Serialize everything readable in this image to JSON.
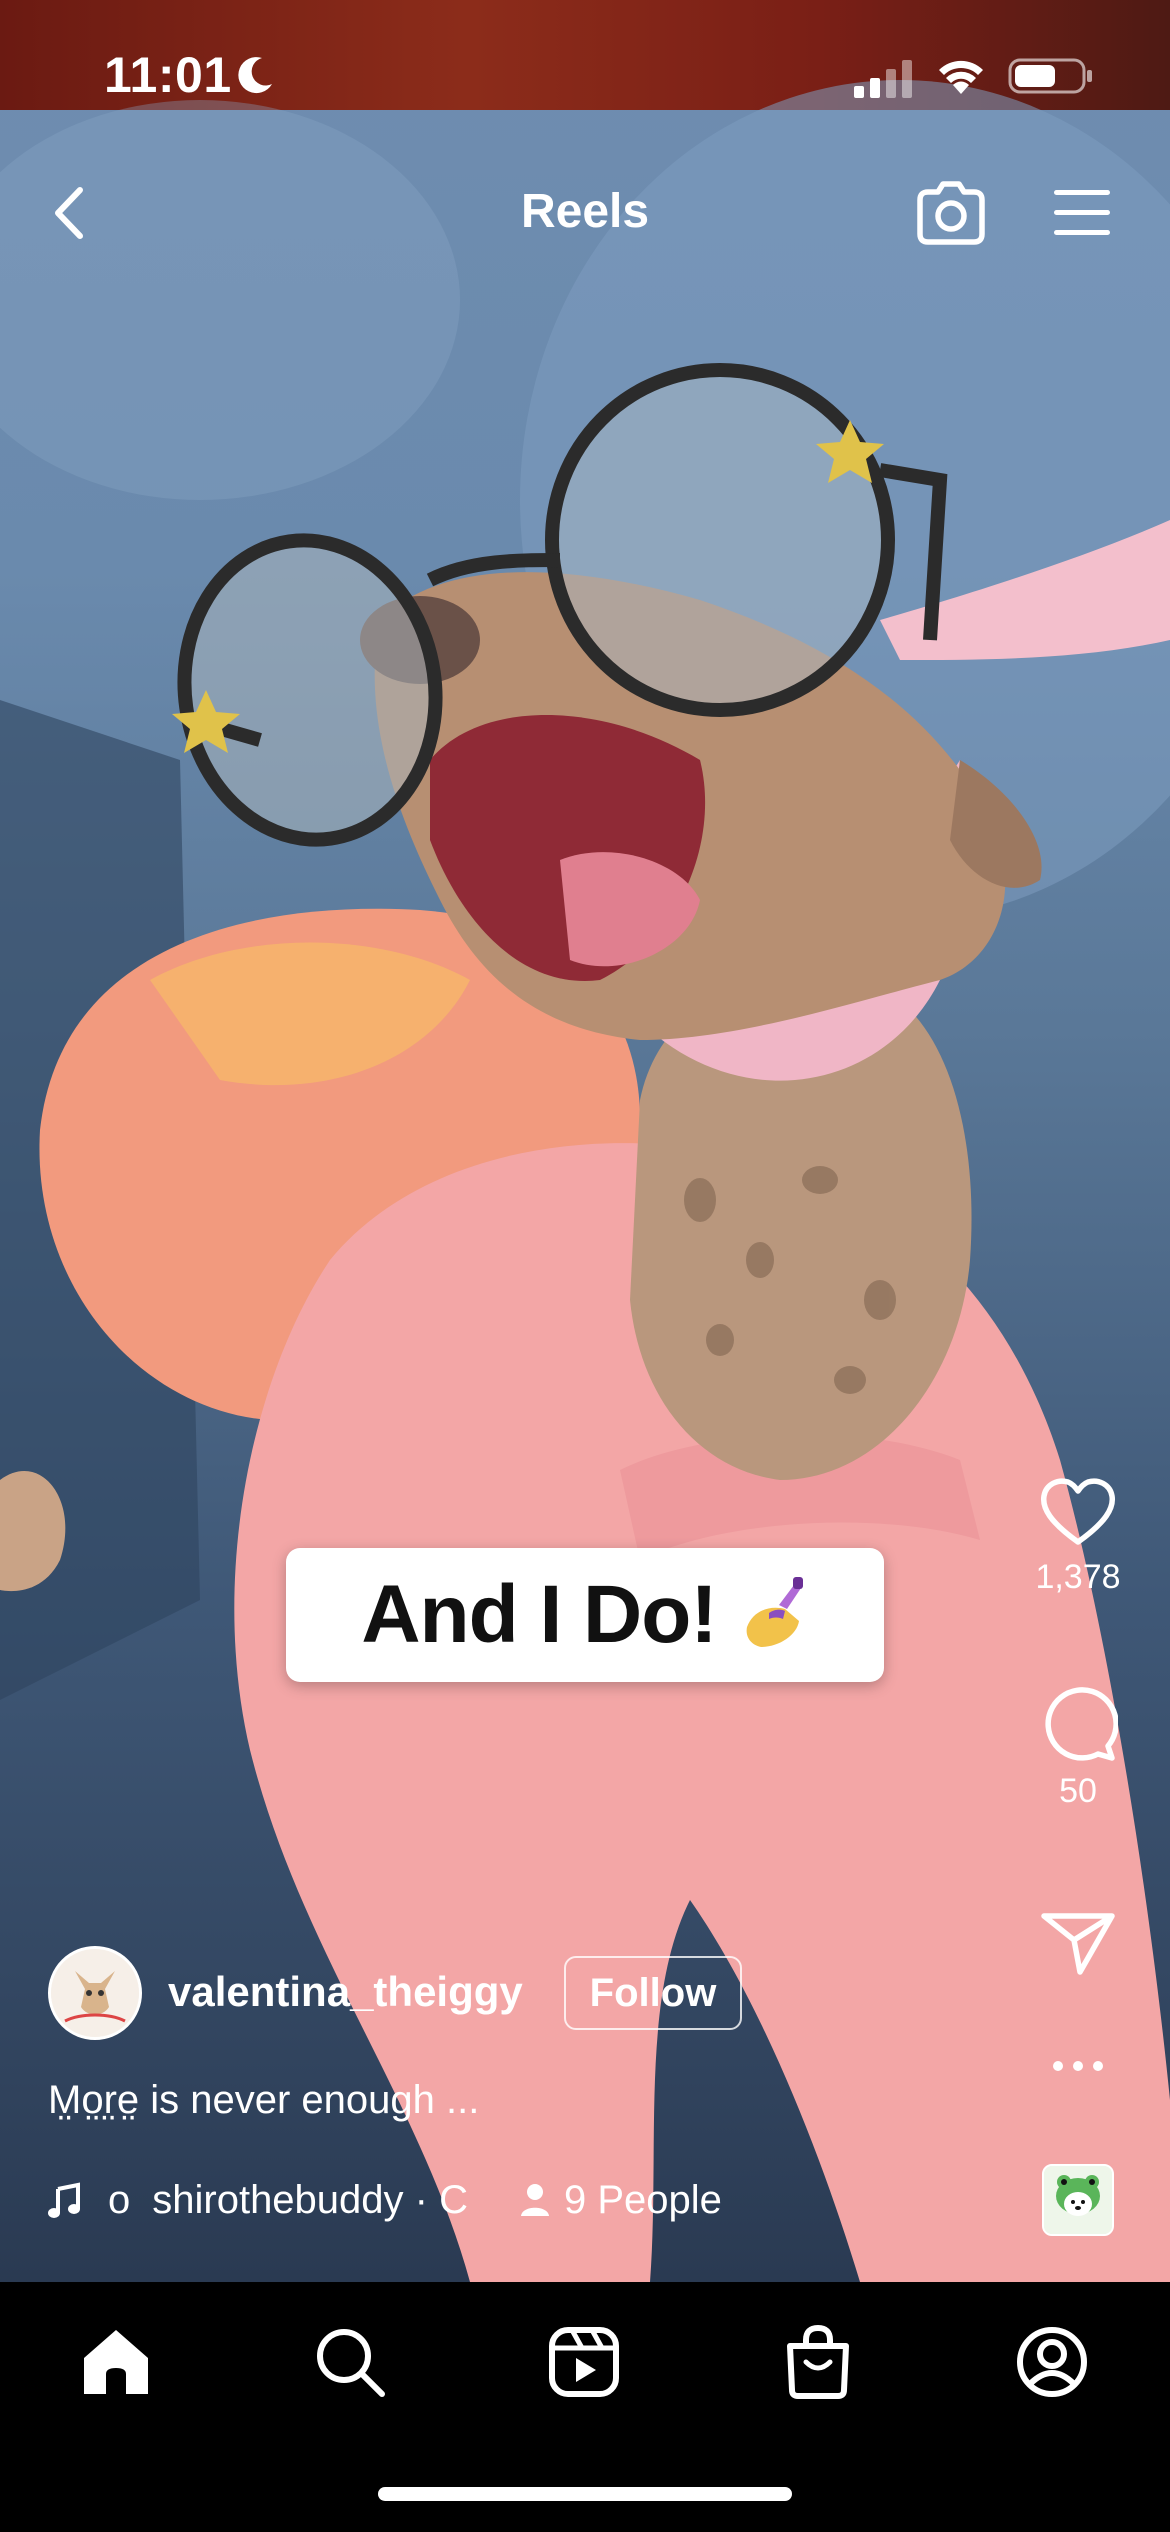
{
  "status_bar": {
    "time": "11:01",
    "icons": [
      "moon-icon",
      "signal-icon",
      "wifi-icon",
      "battery-icon"
    ]
  },
  "header": {
    "title": "Reels",
    "icons": [
      "chevron-left-icon",
      "camera-icon",
      "menu-icon"
    ]
  },
  "sticker": {
    "text": "And I Do!",
    "emoji": "nail-polish-emoji"
  },
  "actions": {
    "like_count": "1,378",
    "comment_count": "50",
    "icons": [
      "heart-icon",
      "comment-icon",
      "send-icon",
      "more-icon"
    ]
  },
  "author": {
    "username": "valentina_theiggy",
    "follow_label": "Follow"
  },
  "caption": {
    "text": "M̤o̤r̤e̤ is never enough ..."
  },
  "audio": {
    "prefix": "o",
    "text": "shirothebuddy · C",
    "people_label": "9 People"
  },
  "tabbar": {
    "items": [
      "home-icon",
      "search-icon",
      "reels-icon",
      "shop-icon",
      "profile-icon"
    ]
  },
  "colors": {
    "background": "#000000",
    "text": "#ffffff",
    "sticker_bg": "#ffffff",
    "sticker_text": "#111111"
  }
}
